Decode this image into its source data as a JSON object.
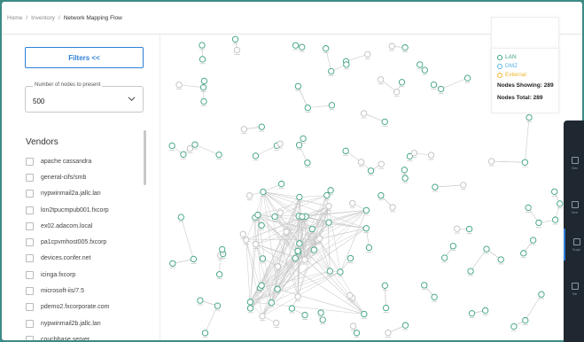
{
  "breadcrumb": {
    "home": "Home",
    "sep1": "/",
    "inventory": "Inventory",
    "sep2": "/",
    "current": "Network Mapping Flow"
  },
  "sidebar": {
    "filters_label": "Filters <<",
    "nodes_select": {
      "label": "Number of nodes to present",
      "value": "500"
    },
    "vendors_title": "Vendors",
    "vendors": [
      "apache cassandra",
      "general-cifs/smb",
      "nypwinmail2a.jallc.lan",
      "lon2tpucmpub001.fxcorp",
      "ex02.adacom.local",
      "pa1cpvmhost005.fxcorp",
      "devices.confer.net",
      "icinga.fxcorp",
      "microsoft-iis/7.5",
      "pdemo2.fxcorporate.com",
      "nypwinmail2b.jallc.lan",
      "couchbase server"
    ]
  },
  "legend": {
    "items": [
      {
        "label": "LAN",
        "color": "#3aa17e"
      },
      {
        "label": "DMZ",
        "color": "#5bb3e8"
      },
      {
        "label": "External",
        "color": "#f0b429"
      }
    ],
    "showing": "Nodes Showing: 289",
    "total": "Nodes Total: 289"
  },
  "graph": {
    "node_color": "#3aa17e",
    "edge_color": "#c9c9c9"
  },
  "right_panel": {
    "items": [
      {
        "icon": "device-icon",
        "label": "Dev"
      },
      {
        "icon": "inventory-icon",
        "label": "Inve"
      },
      {
        "icon": "super-icon",
        "label": "Supe"
      },
      {
        "icon": "net-icon",
        "label": "Ne"
      }
    ]
  }
}
